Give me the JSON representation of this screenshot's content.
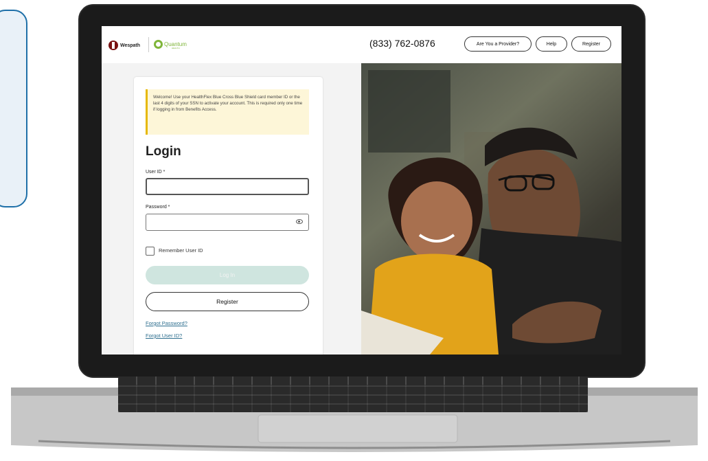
{
  "header": {
    "brand_primary": "Wespath",
    "brand_secondary": "Quantum",
    "brand_secondary_sub": "HEALTH",
    "phone": "(833) 762-0876",
    "provider_button": "Are You a Provider?",
    "help_button": "Help",
    "register_button": "Register"
  },
  "login": {
    "notice": "Welcome! Use your HealthFlex Blue Cross Blue Shield card member ID or the last 4 digits of your SSN to activate your account. This is required only one time if logging in from Benefits Access.",
    "title": "Login",
    "user_id_label": "User ID *",
    "user_id_value": "",
    "password_label": "Password *",
    "password_value": "",
    "remember_label": "Remember User ID",
    "remember_checked": false,
    "login_button": "Log In",
    "register_button": "Register",
    "forgot_password": "Forgot Password?",
    "forgot_user_id": "Forgot User ID?"
  },
  "colors": {
    "side_card_border": "#1d6fa8",
    "notice_accent": "#e6b800",
    "login_button_bg": "#cfe5df",
    "link": "#2d6e8e",
    "quantum_green": "#7fb539",
    "wespath_red": "#7a1212"
  },
  "icons": {
    "password_toggle": "eye-icon"
  }
}
